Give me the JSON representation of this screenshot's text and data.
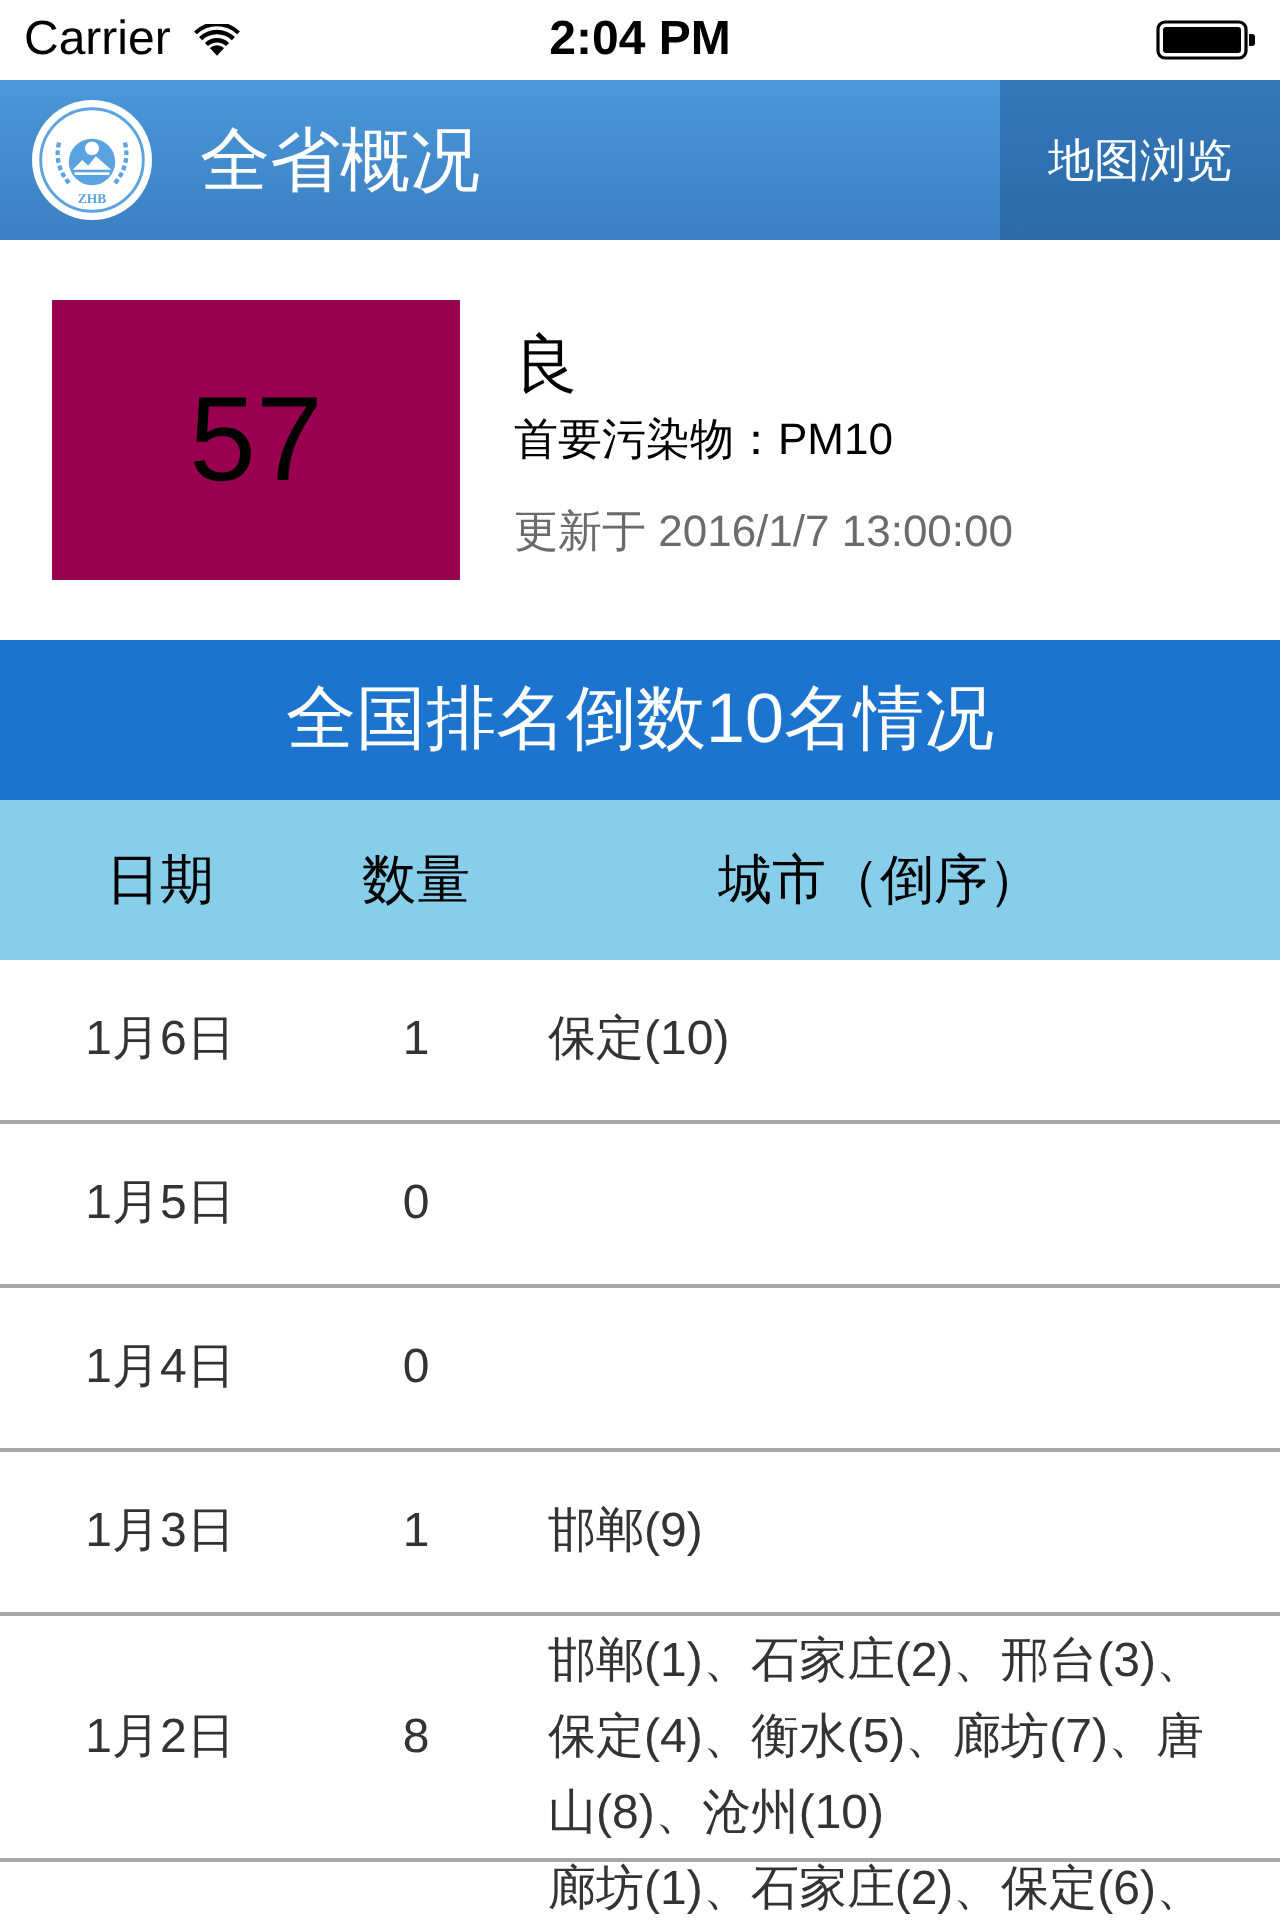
{
  "status_bar": {
    "carrier": "Carrier",
    "time": "2:04 PM"
  },
  "nav_bar": {
    "logo_text": "ZHB",
    "title": "全省概况",
    "action_button": "地图浏览"
  },
  "aqi": {
    "value": "57",
    "color": "#990050",
    "level_label": "良",
    "primary_pollutant": "首要污染物：PM10",
    "updated": "更新于 2016/1/7 13:00:00"
  },
  "ranking": {
    "title": "全国排名倒数10名情况",
    "columns": [
      "日期",
      "数量",
      "城市（倒序）"
    ],
    "rows": [
      {
        "date": "1月6日",
        "count": "1",
        "cities": "保定(10)"
      },
      {
        "date": "1月5日",
        "count": "0"
      },
      {
        "date": "1月4日",
        "count": "0"
      },
      {
        "date": "1月3日",
        "count": "1",
        "cities": "邯郸(9)"
      },
      {
        "date": "1月2日",
        "count": "8",
        "cities": "邯郸(1)、石家庄(2)、邢台(3)、保定(4)、衡水(5)、廊坊(7)、唐山(8)、沧州(10)"
      },
      {
        "cities": "廊坊(1)、石家庄(2)、保定(6)、"
      }
    ]
  }
}
